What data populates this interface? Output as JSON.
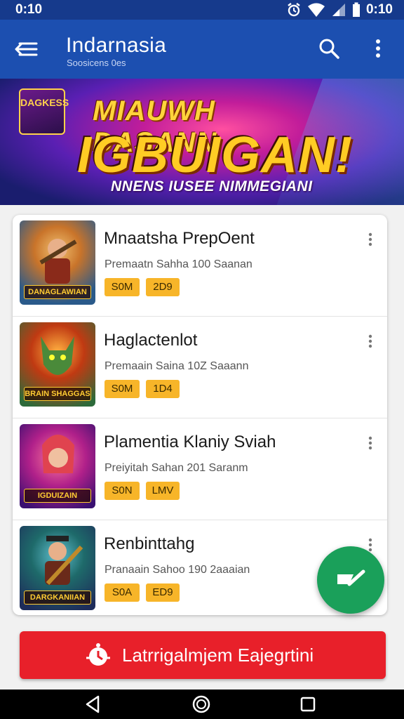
{
  "status_bar": {
    "time": "0:10",
    "clock_right": "0:10"
  },
  "app_bar": {
    "title": "Indarnasia",
    "subtitle": "Soosicens 0es"
  },
  "banner": {
    "logo_text": "DAGKESS",
    "line1": "MIAUWH DASANN",
    "line2": "IGBUIGAN!",
    "tagline": "NNENS IUSEE NIMMEGIANI"
  },
  "items": [
    {
      "title": "Mnaatsha PrepOent",
      "meta": "Premaatn Sahha 100 Saanan",
      "badge_a": "S0M",
      "badge_b": "2D9",
      "thumb_label": "DANAGLAWIAN",
      "thumb_colors": [
        "#2a5a8a",
        "#c9742a"
      ]
    },
    {
      "title": "Haglactenlot",
      "meta": "Premaain Saina 10Z Saaann",
      "badge_a": "S0M",
      "badge_b": "1D4",
      "thumb_label": "BRAIN SHAGGAS",
      "thumb_colors": [
        "#c03a12",
        "#2d6a3a"
      ]
    },
    {
      "title": "Plamentia Klaniy Sviah",
      "meta": "Preiyitah Sahan 201 Saranm",
      "badge_a": "S0N",
      "badge_b": "LMV",
      "thumb_label": "IGDUIZAIN",
      "thumb_colors": [
        "#7a1e9e",
        "#e0434f"
      ]
    },
    {
      "title": "Renbinttahg",
      "meta": "Pranaain Sahoo 190 2aaaian",
      "badge_a": "S0A",
      "badge_b": "ED9",
      "thumb_label": "DARGKANIIAN",
      "thumb_colors": [
        "#1e3c6a",
        "#c08a2a"
      ]
    }
  ],
  "cta": {
    "label": "Latrrigalmjem Eajegrtini"
  },
  "icons": {
    "menu": "hamburger-back-icon",
    "search": "search-icon",
    "more": "more-vert-icon",
    "fab": "edit-icon",
    "cta": "clock-icon",
    "nav": [
      "back-icon",
      "home-icon",
      "recents-icon"
    ]
  },
  "colors": {
    "app_bar": "#1c4fb0",
    "badge": "#f7b529",
    "fab": "#1aa05a",
    "cta": "#e8202a"
  }
}
